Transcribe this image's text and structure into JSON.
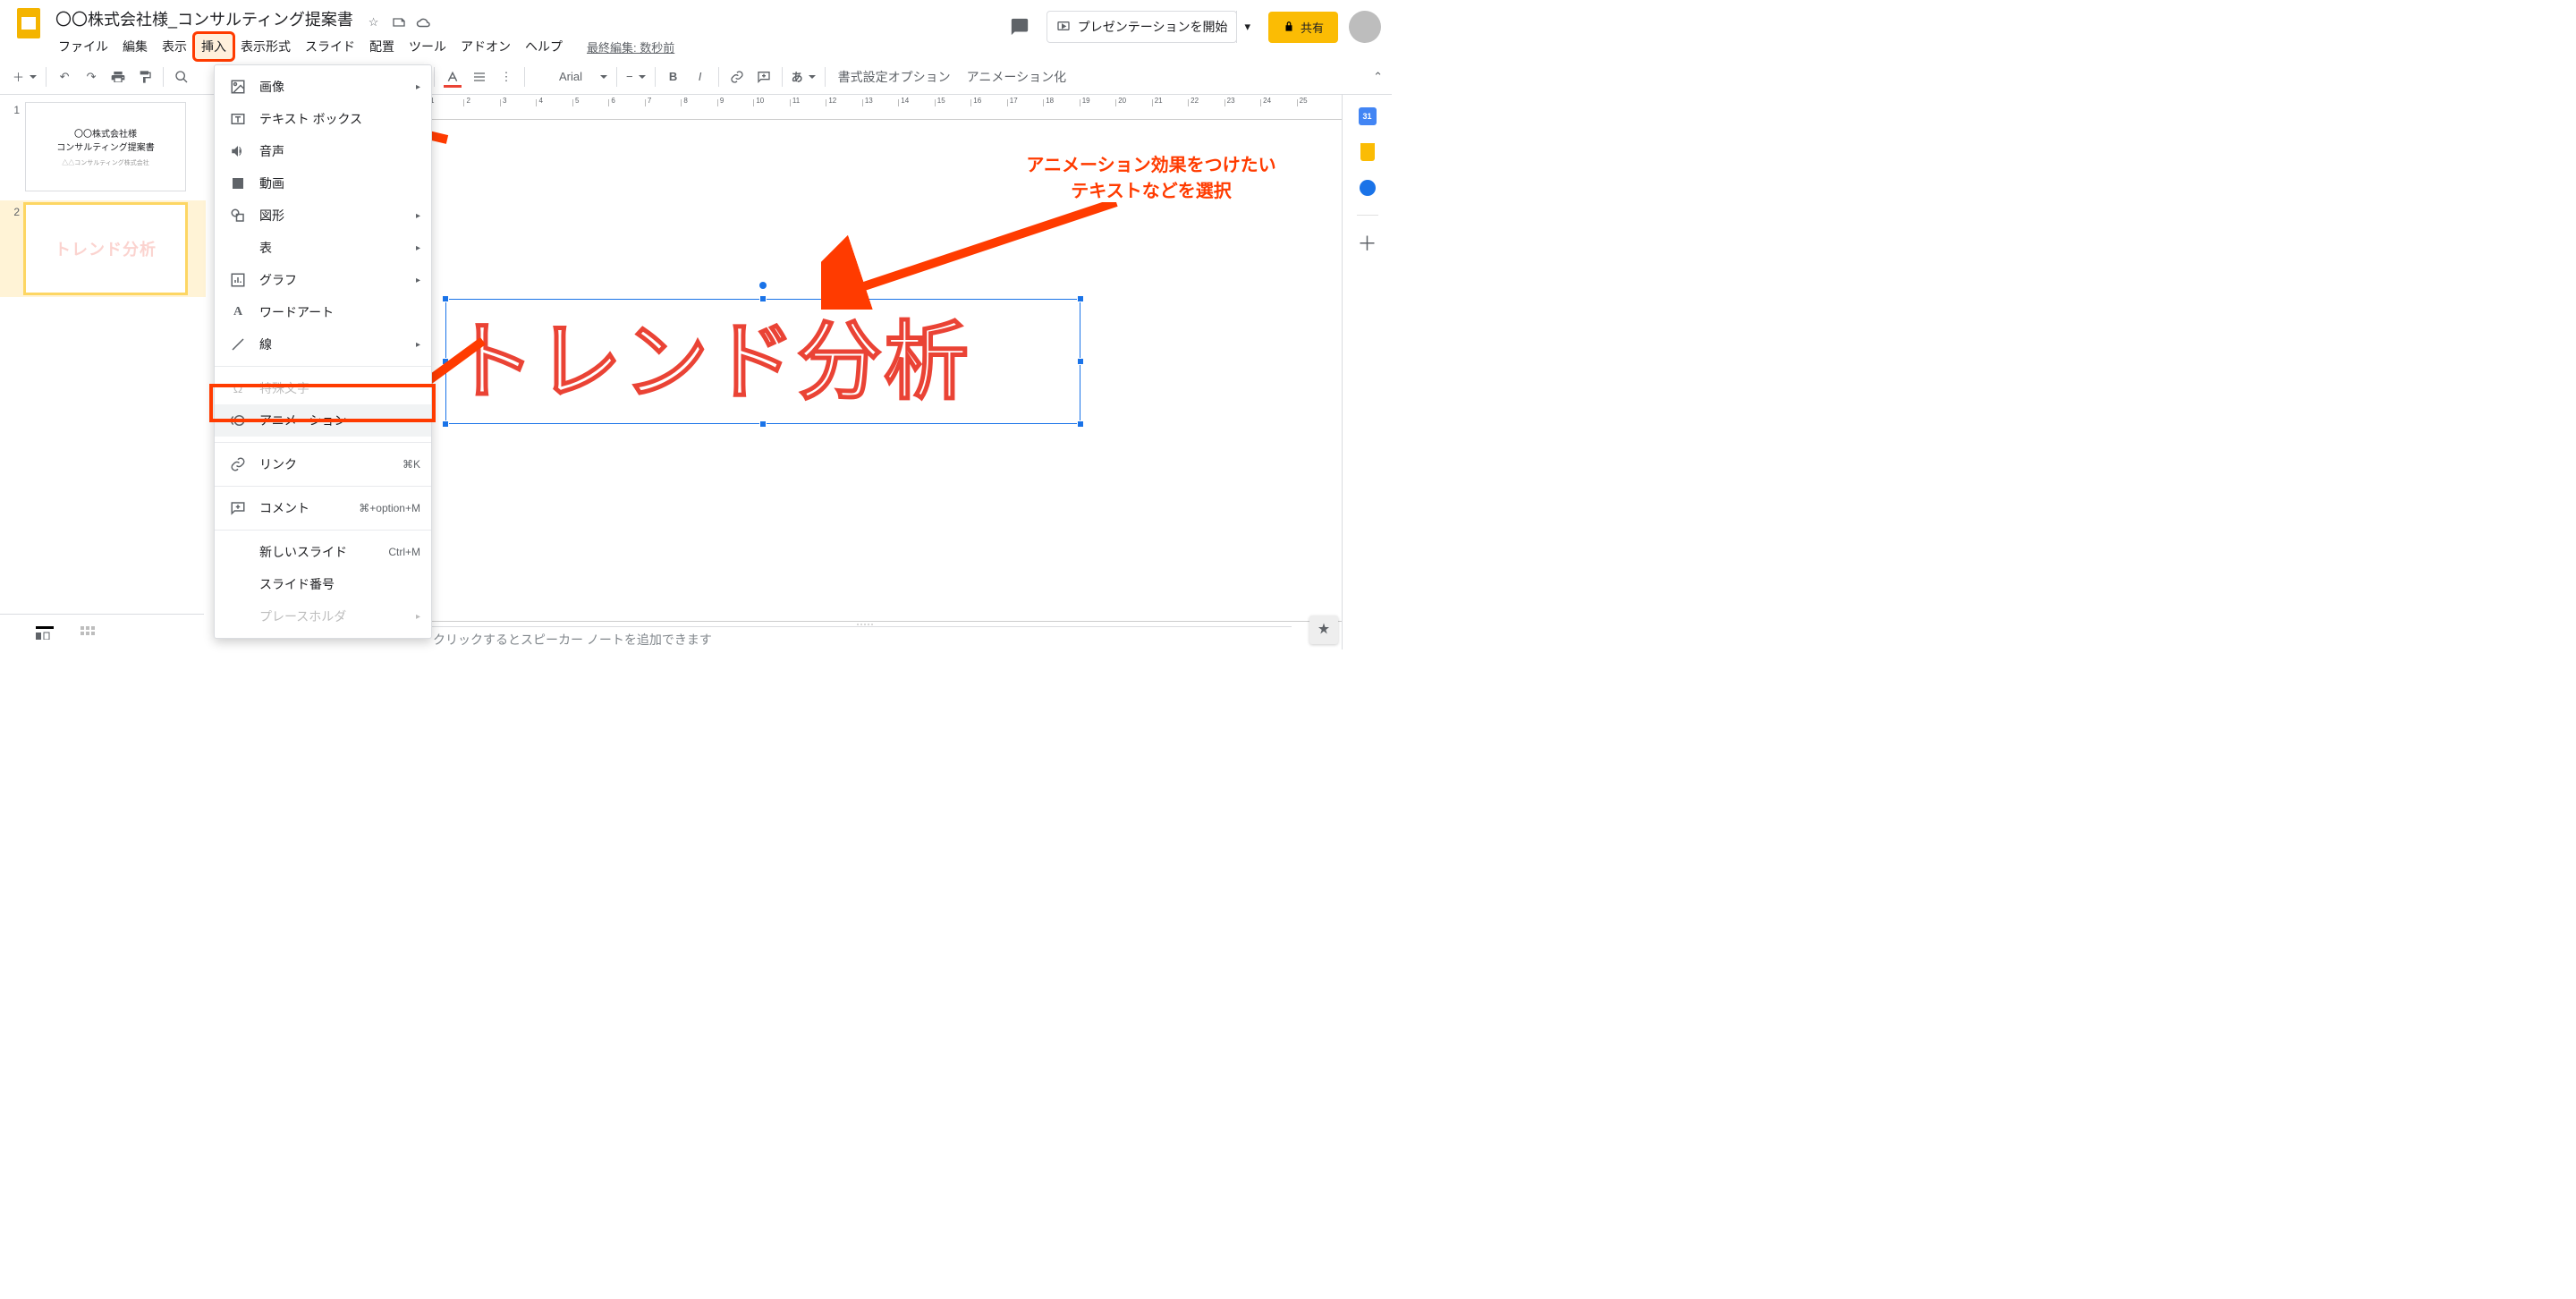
{
  "header": {
    "doc_title": "〇〇株式会社様_コンサルティング提案書",
    "last_edit": "最終編集: 数秒前",
    "present_label": "プレゼンテーションを開始",
    "share_label": "共有"
  },
  "menubar": {
    "file": "ファイル",
    "edit": "編集",
    "view": "表示",
    "insert": "挿入",
    "format": "表示形式",
    "slide": "スライド",
    "arrange": "配置",
    "tool": "ツール",
    "addon": "アドオン",
    "help": "ヘルプ"
  },
  "toolbar": {
    "font": "Arial",
    "format_options": "書式設定オプション",
    "animate": "アニメーション化"
  },
  "dropdown": {
    "image": "画像",
    "textbox": "テキスト ボックス",
    "audio": "音声",
    "video": "動画",
    "shape": "図形",
    "table": "表",
    "chart": "グラフ",
    "wordart": "ワードアート",
    "line": "線",
    "special": "特殊文字",
    "animation": "アニメーション",
    "link": "リンク",
    "link_sc": "⌘K",
    "comment": "コメント",
    "comment_sc": "⌘+option+M",
    "newslide": "新しいスライド",
    "newslide_sc": "Ctrl+M",
    "slidenum": "スライド番号",
    "placeholder": "プレースホルダ"
  },
  "filmstrip": {
    "n1": "1",
    "n2": "2",
    "s1_l1": "〇〇株式会社様",
    "s1_l2": "コンサルティング提案書",
    "s1_l3": "△△コンサルティング株式会社",
    "s2_text": "トレンド分析"
  },
  "canvas": {
    "wordart": "トレンド分析"
  },
  "annotations": {
    "line1": "アニメーション効果をつけたい",
    "line2": "テキストなどを選択"
  },
  "notes": {
    "placeholder": "クリックするとスピーカー ノートを追加できます"
  },
  "rail": {
    "cal_day": "31"
  },
  "ruler": {
    "t1": "1",
    "t2": "2",
    "t3": "3",
    "t4": "4",
    "t5": "5",
    "t6": "6",
    "t7": "7",
    "t8": "8",
    "t9": "9",
    "t10": "10",
    "t11": "11",
    "t12": "12",
    "t13": "13",
    "t14": "14",
    "t15": "15",
    "t16": "16",
    "t17": "17",
    "t18": "18",
    "t19": "19",
    "t20": "20",
    "t21": "21",
    "t22": "22",
    "t23": "23",
    "t24": "24",
    "t25": "25"
  }
}
